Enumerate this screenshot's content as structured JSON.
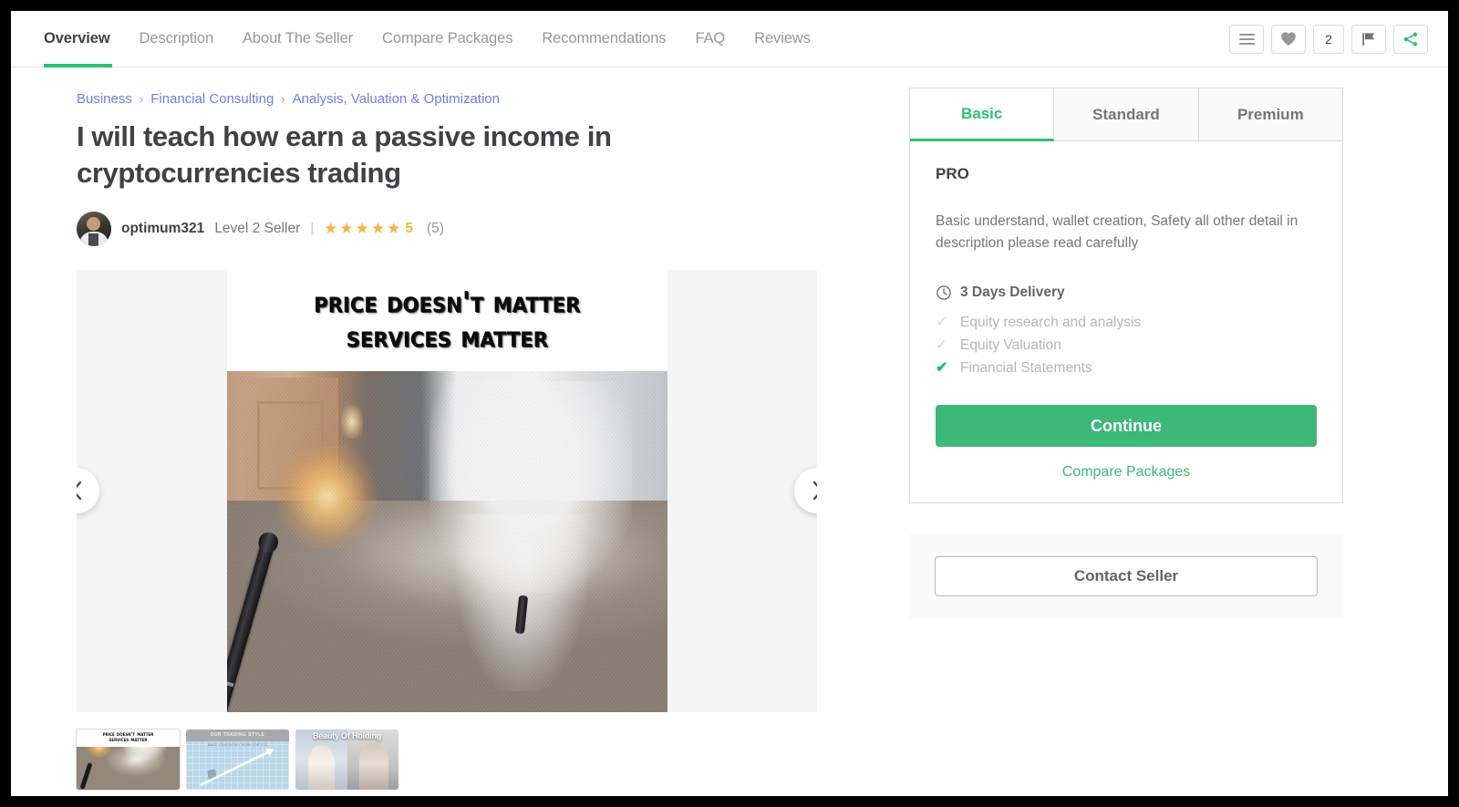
{
  "nav": {
    "tabs": [
      {
        "label": "Overview",
        "active": true
      },
      {
        "label": "Description",
        "active": false
      },
      {
        "label": "About The Seller",
        "active": false
      },
      {
        "label": "Compare Packages",
        "active": false
      },
      {
        "label": "Recommendations",
        "active": false
      },
      {
        "label": "FAQ",
        "active": false
      },
      {
        "label": "Reviews",
        "active": false
      }
    ],
    "actions": {
      "menu_icon": "hamburger-menu-icon",
      "favorite_icon": "heart-icon",
      "favorite_count": "2",
      "report_icon": "flag-icon",
      "share_icon": "share-icon"
    }
  },
  "breadcrumb": {
    "items": [
      "Business",
      "Financial Consulting",
      "Analysis, Valuation & Optimization"
    ],
    "separator": "›"
  },
  "gig": {
    "title": "I will teach how earn a passive income in cryptocurrencies trading"
  },
  "seller": {
    "avatar_icon": "seller-avatar",
    "name": "optimum321",
    "level": "Level 2 Seller",
    "divider": "|",
    "stars": "★★★★★",
    "rating": "5",
    "reviews_count": "(5)"
  },
  "gallery": {
    "prev_icon": "chevron-left-icon",
    "next_icon": "chevron-right-icon",
    "slide": {
      "banner_line1": "Price Doesn't Matter",
      "banner_line2": "Services Matter",
      "alt": "flashlight beams on carpet"
    },
    "thumbnails": [
      {
        "name": "thumb-price-doesnt-matter",
        "line1": "Price Doesn't Matter",
        "line2": "Services Matter",
        "active": true
      },
      {
        "name": "thumb-our-trading-style",
        "title": "OUR TRADING STYLE",
        "subtitle": "MAKE YOUR MONEY WORK FOR YOU",
        "active": false
      },
      {
        "name": "thumb-beauty-of-holding",
        "title": "Beauty Of Holding",
        "active": false
      }
    ]
  },
  "package": {
    "tabs": [
      {
        "label": "Basic",
        "active": true
      },
      {
        "label": "Standard",
        "active": false
      },
      {
        "label": "Premium",
        "active": false
      }
    ],
    "name": "PRO",
    "description": "Basic understand, wallet creation, Safety all other detail in description please read carefully",
    "delivery_icon": "clock-icon",
    "delivery": "3 Days Delivery",
    "features": [
      {
        "label": "Equity research and analysis",
        "included": false,
        "check": "✓"
      },
      {
        "label": "Equity Valuation",
        "included": false,
        "check": "✓"
      },
      {
        "label": "Financial Statements",
        "included": true,
        "check": "✔"
      }
    ],
    "continue_label": "Continue",
    "compare_label": "Compare Packages"
  },
  "contact": {
    "button_label": "Contact Seller"
  },
  "colors": {
    "accent_green": "#2ec071",
    "button_green": "#3cb878",
    "link_blue": "#6c7fed",
    "star_orange": "#ffb33e",
    "text_dark": "#404145",
    "text_muted": "#74767e"
  }
}
